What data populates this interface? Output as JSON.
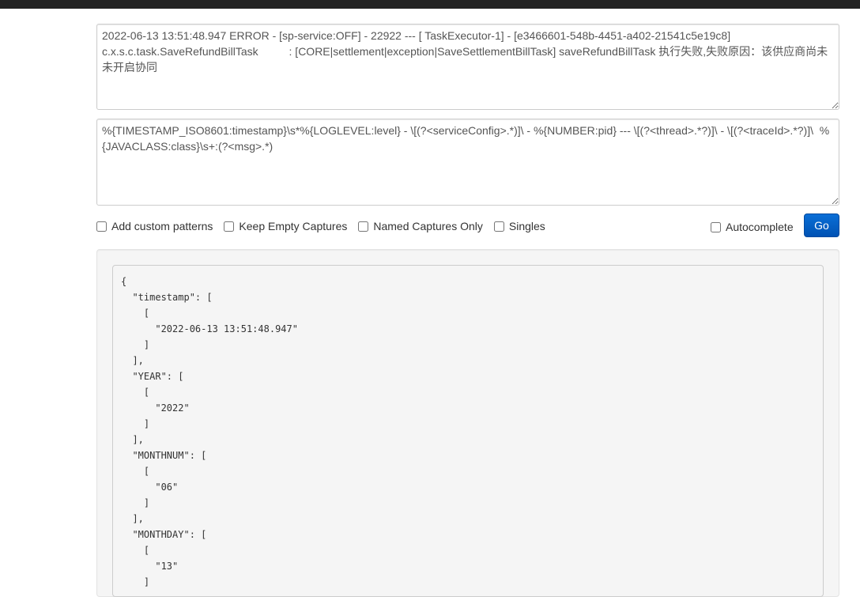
{
  "log_input": {
    "value": "2022-06-13 13:51:48.947 ERROR - [sp-service:OFF] - 22922 --- [ TaskExecutor-1] - [e3466601-548b-4451-a402-21541c5e19c8] c.x.s.c.task.SaveRefundBillTask          : [CORE|settlement|exception|SaveSettlementBillTask] saveRefundBillTask 执行失败,失败原因：该供应商尚未未开启协同"
  },
  "pattern_input": {
    "value": "%{TIMESTAMP_ISO8601:timestamp}\\s*%{LOGLEVEL:level} - \\[(?<serviceConfig>.*)]\\ - %{NUMBER:pid} --- \\[(?<thread>.*?)]\\ - \\[(?<traceId>.*?)]\\  %{JAVACLASS:class}\\s+:(?<msg>.*)"
  },
  "options": {
    "add_custom_patterns": "Add custom patterns",
    "keep_empty_captures": "Keep Empty Captures",
    "named_captures_only": "Named Captures Only",
    "singles": "Singles",
    "autocomplete": "Autocomplete"
  },
  "go_label": "Go",
  "result_lines": [
    "{",
    "  \"timestamp\": [",
    "    [",
    "      \"2022-06-13 13:51:48.947\"",
    "    ]",
    "  ],",
    "  \"YEAR\": [",
    "    [",
    "      \"2022\"",
    "    ]",
    "  ],",
    "  \"MONTHNUM\": [",
    "    [",
    "      \"06\"",
    "    ]",
    "  ],",
    "  \"MONTHDAY\": [",
    "    [",
    "      \"13\"",
    "    ]"
  ],
  "colors": {
    "topbar": "#222222",
    "go_button": "#0a6fd6",
    "well": "#f5f5f5"
  }
}
